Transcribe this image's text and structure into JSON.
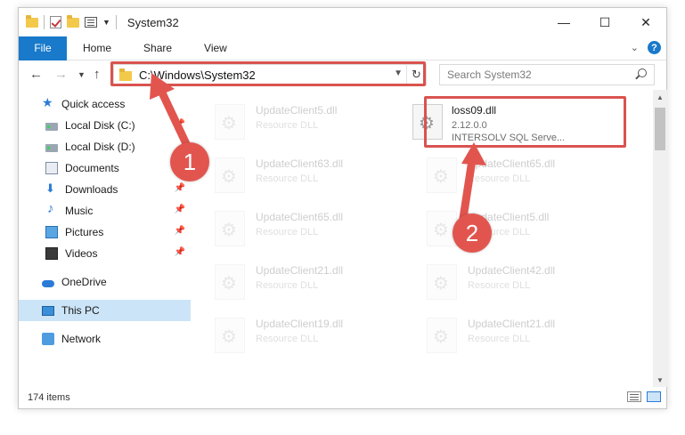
{
  "window": {
    "title": "System32",
    "controls": {
      "minimize": "—",
      "maximize": "☐",
      "close": "✕"
    }
  },
  "ribbon": {
    "tabs": [
      {
        "label": "File"
      },
      {
        "label": "Home"
      },
      {
        "label": "Share"
      },
      {
        "label": "View"
      }
    ]
  },
  "address": {
    "path": "C:\\Windows\\System32"
  },
  "search": {
    "placeholder": "Search System32"
  },
  "sidebar": {
    "items": [
      {
        "label": "Quick access",
        "icon": "star-icon"
      },
      {
        "label": "Local Disk (C:)",
        "icon": "drive-icon"
      },
      {
        "label": "Local Disk (D:)",
        "icon": "drive-icon"
      },
      {
        "label": "Documents",
        "icon": "documents-icon"
      },
      {
        "label": "Downloads",
        "icon": "downloads-icon"
      },
      {
        "label": "Music",
        "icon": "music-icon"
      },
      {
        "label": "Pictures",
        "icon": "pictures-icon"
      },
      {
        "label": "Videos",
        "icon": "videos-icon"
      },
      {
        "label": "OneDrive",
        "icon": "cloud-icon"
      },
      {
        "label": "This PC",
        "icon": "computer-icon"
      },
      {
        "label": "Network",
        "icon": "network-icon"
      }
    ]
  },
  "files": {
    "highlighted": {
      "name": "loss09.dll",
      "version": "2.12.0.0",
      "description": "INTERSOLV SQL Serve..."
    },
    "items": [
      {
        "name": "UpdateClient5.dll",
        "type": "Resource DLL"
      },
      {
        "name": "UpdateClient63.dll",
        "type": "Resource DLL"
      },
      {
        "name": "UpdateClient65.dll",
        "type": "Resource DLL"
      },
      {
        "name": "UpdateClient65.dll",
        "type": "Resource DLL"
      },
      {
        "name": "UpdateClient5.dll",
        "type": "Resource DLL"
      },
      {
        "name": "UpdateClient21.dll",
        "type": "Resource DLL"
      },
      {
        "name": "UpdateClient42.dll",
        "type": "Resource DLL"
      },
      {
        "name": "UpdateClient19.dll",
        "type": "Resource DLL"
      },
      {
        "name": "UpdateClient21.dll",
        "type": "Resource DLL"
      }
    ]
  },
  "status": {
    "item_count": "174 items"
  },
  "annotations": {
    "step1": "1",
    "step2": "2",
    "color": "#e2554f"
  }
}
